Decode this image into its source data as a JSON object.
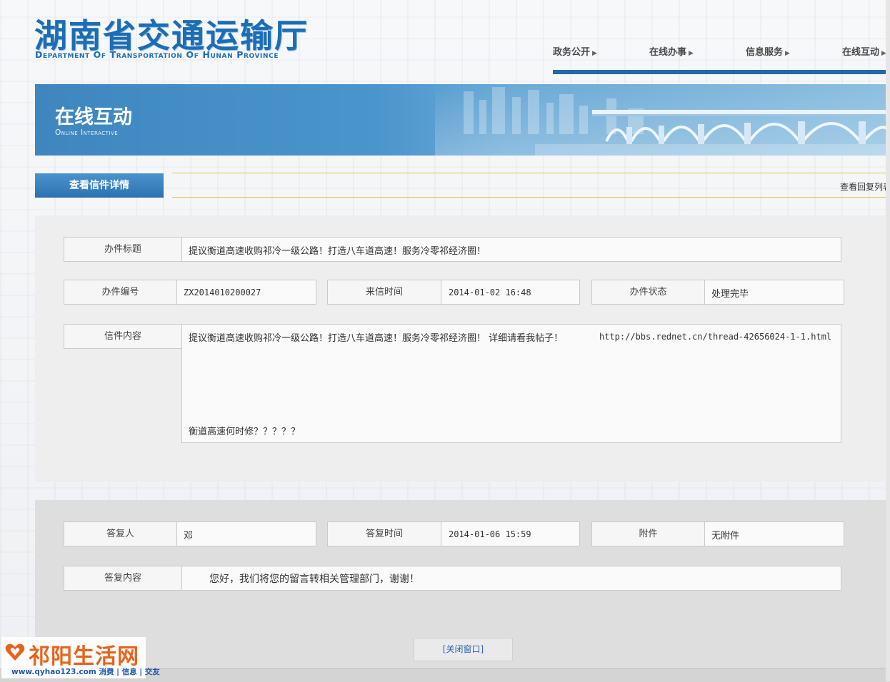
{
  "header": {
    "logo_cn": "湖南省交通运输厅",
    "logo_en": "Department Of Transportation Of Hunan Province",
    "nav": [
      "政务公开",
      "在线办事",
      "信息服务",
      "在线互动"
    ]
  },
  "banner": {
    "title": "在线互动",
    "subtitle": "Online Interactive"
  },
  "section": {
    "tab_label": "查看信件详情",
    "reply_list_link": "查看回复列表"
  },
  "letter": {
    "title_label": "办件标题",
    "title_value": "提议衡道高速收购祁冷一级公路！打造八车道高速！服务冷零祁经济圈！",
    "number_label": "办件编号",
    "number_value": "ZX2014010200027",
    "time_label": "来信时间",
    "time_value": "2014-01-02 16:48",
    "status_label": "办件状态",
    "status_value": "处理完毕",
    "content_label": "信件内容",
    "content_line1": "提议衡道高速收购祁冷一级公路！打造八车道高速！服务冷零祁经济圈！  详细请看我帖子！  ",
    "content_url": "http://bbs.rednet.cn/thread-42656024-1-1.html",
    "content_line2": "衡道高速何时修？？？？？"
  },
  "reply": {
    "replier_label": "答复人",
    "replier_value": "邓",
    "reply_time_label": "答复时间",
    "reply_time_value": "2014-01-06 15:59",
    "attachment_label": "附件",
    "attachment_value": "无附件",
    "content_label": "答复内容",
    "content_value": "您好，我们将您的留言转相关管理部门，谢谢！"
  },
  "close_button": "[关闭窗口]",
  "watermark": {
    "brand": "祁阳生活网",
    "url": "www.qyhao123.com 消费 | 信息 | 交友"
  },
  "colors": {
    "brand_blue": "#1d6db5",
    "nav_bar": "#1f6aa8",
    "tab_blue": "#2b72b2",
    "gold_line": "#e8c24a",
    "watermark_orange": "#e8621b"
  }
}
